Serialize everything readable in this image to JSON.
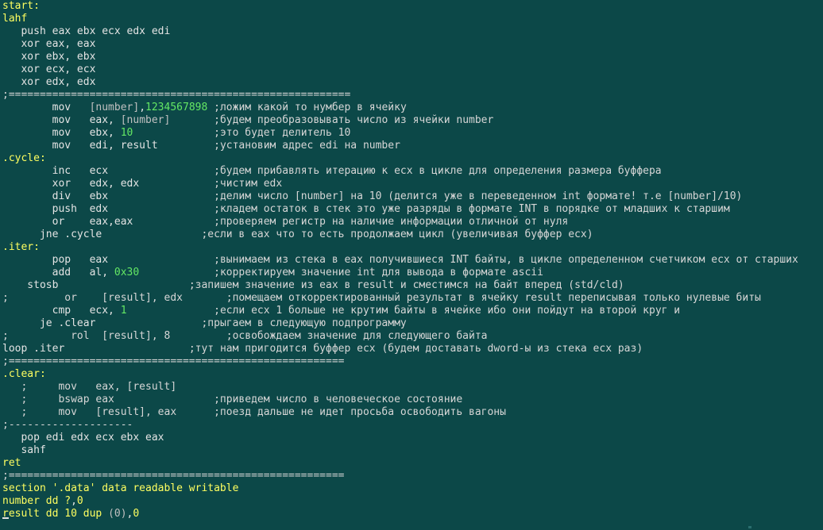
{
  "colors": {
    "background": "#0c4848",
    "text": "#e4e4e4",
    "label": "#ffff60",
    "number": "#64e864",
    "bracket": "#c0c0c0",
    "comment": "#d6d6d6"
  },
  "lines": [
    [
      {
        "t": "label",
        "v": "start:"
      }
    ],
    [
      {
        "t": "label",
        "v": "lahf"
      }
    ],
    [
      {
        "t": "text",
        "v": "   push eax ebx ecx edx edi"
      }
    ],
    [
      {
        "t": "text",
        "v": "   xor eax, eax"
      }
    ],
    [
      {
        "t": "text",
        "v": "   xor ebx, ebx"
      }
    ],
    [
      {
        "t": "text",
        "v": "   xor ecx, ecx"
      }
    ],
    [
      {
        "t": "text",
        "v": "   xor edx, edx"
      }
    ],
    [
      {
        "t": "sep",
        "v": ";======================================================="
      }
    ],
    [
      {
        "t": "text",
        "v": "        mov   "
      },
      {
        "t": "bracket",
        "v": "[number]"
      },
      {
        "t": "text",
        "v": ","
      },
      {
        "t": "num",
        "v": "1234567898"
      },
      {
        "t": "comment",
        "v": " ;ложим какой то нумбер в ячейку"
      }
    ],
    [
      {
        "t": "text",
        "v": "        mov   eax, "
      },
      {
        "t": "bracket",
        "v": "[number]"
      },
      {
        "t": "comment",
        "v": "       ;будем преобразовывать число из ячейки number"
      }
    ],
    [
      {
        "t": "text",
        "v": "        mov   ebx, "
      },
      {
        "t": "num",
        "v": "10"
      },
      {
        "t": "comment",
        "v": "             ;это будет делитель 10"
      }
    ],
    [
      {
        "t": "text",
        "v": "        mov   edi, result"
      },
      {
        "t": "comment",
        "v": "         ;установим адрес edi на number"
      }
    ],
    [
      {
        "t": "label",
        "v": ".cycle:"
      }
    ],
    [
      {
        "t": "text",
        "v": "        inc   ecx"
      },
      {
        "t": "comment",
        "v": "                 ;будем прибавлять итерацию к ecx в цикле для определения размера буффера"
      }
    ],
    [
      {
        "t": "text",
        "v": "        xor   edx, edx"
      },
      {
        "t": "comment",
        "v": "            ;чистим edx"
      }
    ],
    [
      {
        "t": "text",
        "v": "        div   ebx"
      },
      {
        "t": "comment",
        "v": "                 ;делим число [number] на 10 (делится уже в переведенном int формате! т.е [number]/10)"
      }
    ],
    [
      {
        "t": "text",
        "v": "        push  edx"
      },
      {
        "t": "comment",
        "v": "                 ;кладем остаток в стек это уже разряды в формате INT в порядке от младших к старшим"
      }
    ],
    [
      {
        "t": "text",
        "v": "        or    eax,eax"
      },
      {
        "t": "comment",
        "v": "             ;проверяем регистр на наличие информации отличной от нуля"
      }
    ],
    [
      {
        "t": "text",
        "v": "      jne .cycle"
      },
      {
        "t": "comment",
        "v": "                ;если в eax что то есть продолжаем цикл (увеличивая буффер ecx)"
      }
    ],
    [
      {
        "t": "label",
        "v": ".iter:"
      }
    ],
    [
      {
        "t": "text",
        "v": "        pop   eax"
      },
      {
        "t": "comment",
        "v": "                 ;вынимаем из стека в eax получившиеся INT байты, в цикле определенном счетчиком ecx от старших"
      }
    ],
    [
      {
        "t": "text",
        "v": "        add   al, "
      },
      {
        "t": "num",
        "v": "0x30"
      },
      {
        "t": "comment",
        "v": "            ;корректируем значение int для вывода в формате ascii"
      }
    ],
    [
      {
        "t": "text",
        "v": "    stosb"
      },
      {
        "t": "comment",
        "v": "                     ;запишем значение из eax в result и сместимся на байт вперед (std/cld)"
      }
    ],
    [
      {
        "t": "comment",
        "v": ";         or    [result], edx       ;помещаем откорректированный результат в ячейку result переписывая только нулевые биты"
      }
    ],
    [
      {
        "t": "text",
        "v": "        cmp   ecx, "
      },
      {
        "t": "num",
        "v": "1"
      },
      {
        "t": "comment",
        "v": "              ;если ecx 1 больше не крутим байты в ячейке ибо они пойдут на второй круг и"
      }
    ],
    [
      {
        "t": "text",
        "v": "      je .clear"
      },
      {
        "t": "comment",
        "v": "                 ;прыгаем в следующую подпрограмму"
      }
    ],
    [
      {
        "t": "comment",
        "v": ";          rol  [result], 8         ;освобождаем значение для следующего байта"
      }
    ],
    [
      {
        "t": "text",
        "v": "loop .iter"
      },
      {
        "t": "comment",
        "v": "                    ;тут нам пригодится буффер ecx (будем доставать dword-ы из стека ecx раз)"
      }
    ],
    [
      {
        "t": "sep",
        "v": ";======================================================"
      }
    ],
    [
      {
        "t": "label",
        "v": ".clear:"
      }
    ],
    [
      {
        "t": "comment",
        "v": "   ;     mov   eax, [result]"
      }
    ],
    [
      {
        "t": "comment",
        "v": "   ;     bswap eax                ;приведем число в человеческое состояние"
      }
    ],
    [
      {
        "t": "comment",
        "v": "   ;     mov   [result], eax      ;поезд дальше не идет просьба освободить вагоны"
      }
    ],
    [
      {
        "t": "sep",
        "v": ";--------------------"
      }
    ],
    [
      {
        "t": "text",
        "v": "   pop edi edx ecx ebx eax"
      }
    ],
    [
      {
        "t": "text",
        "v": "   sahf"
      }
    ],
    [
      {
        "t": "label",
        "v": "ret"
      }
    ],
    [
      {
        "t": "sep",
        "v": ";======================================================"
      }
    ],
    [
      {
        "t": "label",
        "v": "section '.data' data readable writable"
      }
    ],
    [
      {
        "t": "label",
        "v": "number dd ?"
      },
      {
        "t": "text",
        "v": ","
      },
      {
        "t": "label",
        "v": "0"
      }
    ],
    [
      {
        "t": "label",
        "v": "result dd 10 dup "
      },
      {
        "t": "bracket",
        "v": "(0)"
      },
      {
        "t": "text",
        "v": ","
      },
      {
        "t": "label",
        "v": "0"
      }
    ]
  ]
}
